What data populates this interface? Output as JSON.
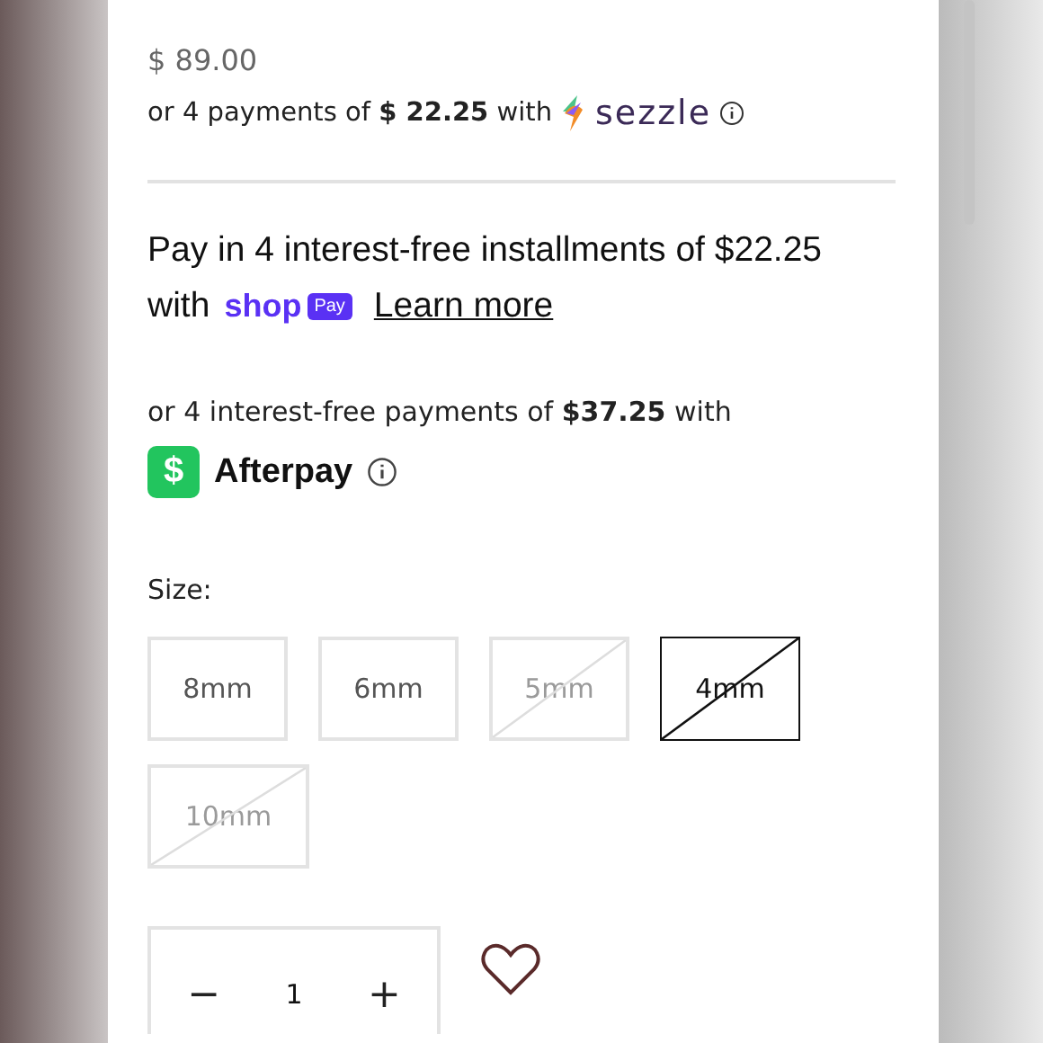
{
  "price": "$ 89.00",
  "sezzle": {
    "text": "or 4 payments of **$ 22.25** with",
    "logo": "sezzle"
  },
  "shop_pay": {
    "text": "Pay in 4 interest-free installments of $22.25",
    "with": "with",
    "logo": "shop",
    "badge": "Pay",
    "link": "Learn more"
  },
  "afterpay": {
    "text": "or 4 interest-free payments of **$37.25** with",
    "icon": "$",
    "logo": "Afterpay"
  },
  "size": {
    "label": "Size:",
    "options": [
      {
        "label": "8mm",
        "available": true,
        "selected": false
      },
      {
        "label": "6mm",
        "available": true,
        "selected": false
      },
      {
        "label": "5mm",
        "available": false,
        "selected": false
      },
      {
        "label": "4mm",
        "available": false,
        "selected": true
      },
      {
        "label": "10mm",
        "available": false,
        "selected": false
      }
    ]
  },
  "quantity": {
    "minus": "−",
    "value": "1",
    "plus": "+"
  },
  "wishlist": {
    "selected": false
  }
}
